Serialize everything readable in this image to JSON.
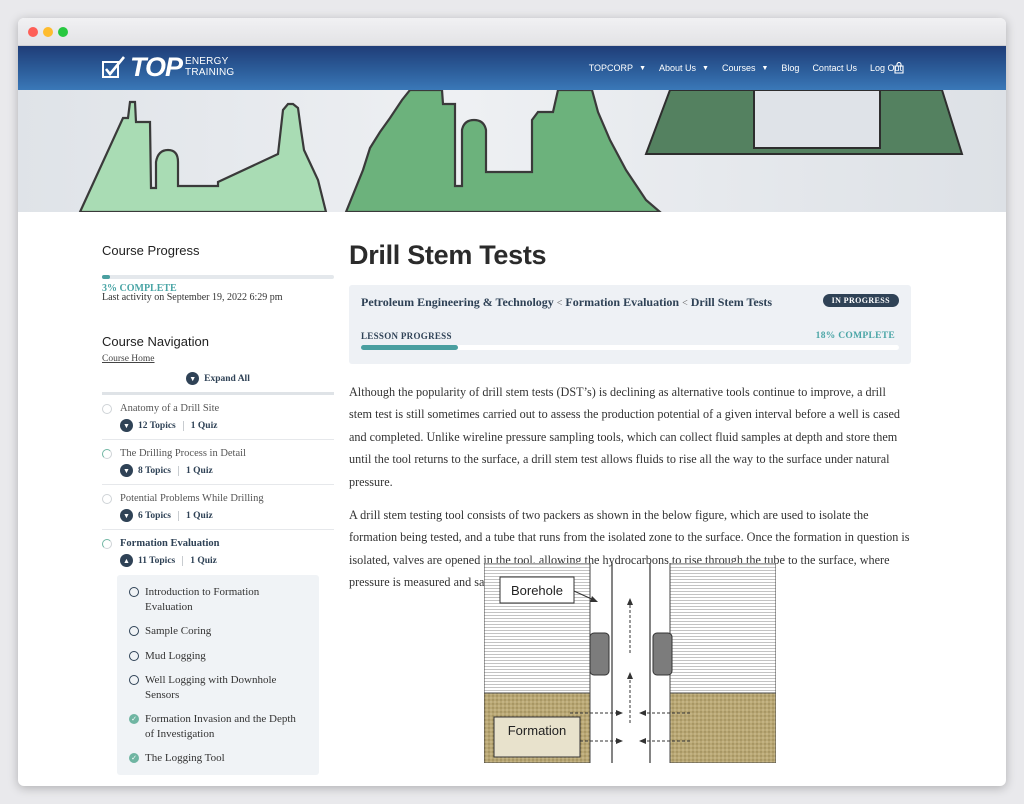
{
  "brand": {
    "logo_main": "TOP",
    "logo_line1": "ENERGY",
    "logo_line2": "TRAINING"
  },
  "nav": {
    "items": [
      {
        "label": "TOPCORP",
        "dropdown": true
      },
      {
        "label": "About Us",
        "dropdown": true
      },
      {
        "label": "Courses",
        "dropdown": true
      },
      {
        "label": "Blog",
        "dropdown": false
      },
      {
        "label": "Contact Us",
        "dropdown": false
      },
      {
        "label": "Log Out",
        "dropdown": false
      }
    ],
    "cart_icon": "shopping-bag-icon"
  },
  "sidebar": {
    "progress_title": "Course Progress",
    "course_progress_fraction": 0.03,
    "course_progress_label": "3% COMPLETE",
    "last_activity": "Last activity on September 19, 2022 6:29 pm",
    "nav_title": "Course Navigation",
    "course_home": "Course Home",
    "expand_all": "Expand All",
    "lessons": [
      {
        "title": "Anatomy of a Drill Site",
        "topics": "12 Topics",
        "quiz": "1 Quiz"
      },
      {
        "title": "The Drilling Process in Detail",
        "topics": "8 Topics",
        "quiz": "1 Quiz"
      },
      {
        "title": "Potential Problems While Drilling",
        "topics": "6 Topics",
        "quiz": "1 Quiz"
      },
      {
        "title": "Formation Evaluation",
        "topics": "11 Topics",
        "quiz": "1 Quiz"
      }
    ],
    "topics": [
      {
        "title": "Introduction to Formation Evaluation",
        "done": false
      },
      {
        "title": "Sample Coring",
        "done": false
      },
      {
        "title": "Mud Logging",
        "done": false
      },
      {
        "title": "Well Logging with Downhole Sensors",
        "done": false
      },
      {
        "title": "Formation Invasion and the Depth of Investigation",
        "done": true
      },
      {
        "title": "The Logging Tool",
        "done": true
      }
    ]
  },
  "article": {
    "title": "Drill Stem Tests",
    "breadcrumb": [
      "Petroleum Engineering & Technology",
      "Formation Evaluation",
      "Drill Stem Tests"
    ],
    "breadcrumb_sep": "<",
    "status_badge": "IN PROGRESS",
    "lesson_progress_label": "LESSON PROGRESS",
    "lesson_progress_pct": "18% COMPLETE",
    "lesson_progress_fraction": 0.18,
    "paragraphs": [
      "Although the popularity of drill stem tests (DST’s) is declining as alternative tools continue to improve, a drill stem test is still sometimes carried out to assess the production potential of a given interval before a well is cased and completed. Unlike wireline pressure sampling tools, which can collect fluid samples at depth and store them until the tool returns to the surface, a drill stem test allows fluids to rise all the way to the surface under natural pressure.",
      "A drill stem testing tool consists of two packers as shown in the below figure, which are used to isolate the formation being tested, and a tube that runs from the isolated zone to the surface. Once the formation in question is isolated, valves are opened in the tool, allowing the hydrocarbons to rise through the tube to the surface, where pressure is measured and samples are collected."
    ],
    "figure_labels": {
      "borehole": "Borehole",
      "formation": "Formation"
    }
  }
}
